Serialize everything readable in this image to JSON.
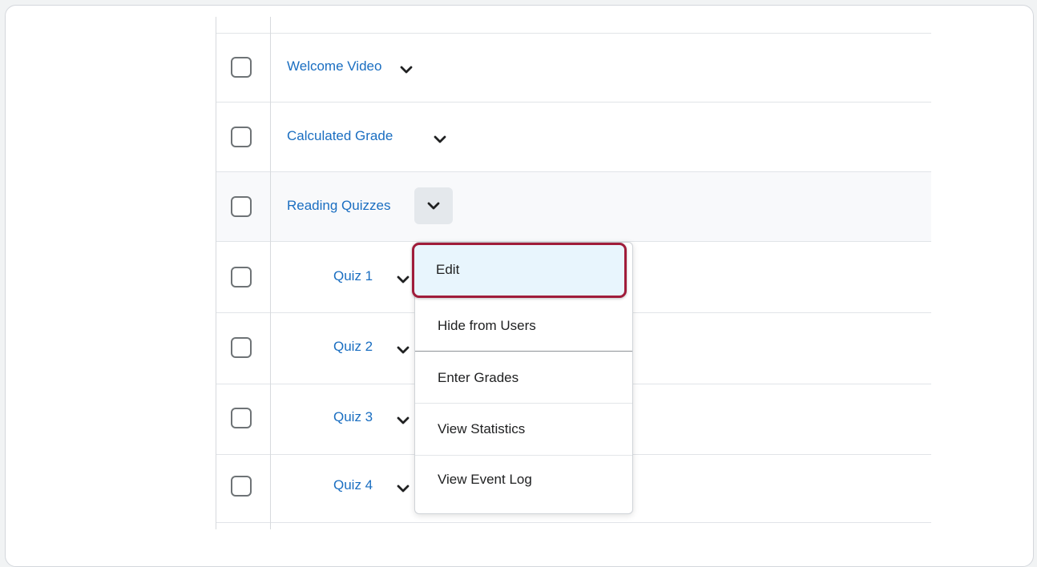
{
  "rows": [
    {
      "label": "Welcome Video",
      "indent": false
    },
    {
      "label": "Calculated Grade",
      "indent": false
    },
    {
      "label": "Reading Quizzes",
      "indent": false,
      "active": true
    },
    {
      "label": "Quiz 1",
      "indent": true
    },
    {
      "label": "Quiz 2",
      "indent": true
    },
    {
      "label": "Quiz 3",
      "indent": true
    },
    {
      "label": "Quiz 4",
      "indent": true
    }
  ],
  "context_menu": {
    "items": [
      {
        "label": "Edit",
        "highlighted": true
      },
      {
        "label": "Hide from Users"
      },
      {
        "label": "Enter Grades"
      },
      {
        "label": "View Statistics"
      },
      {
        "label": "View Event Log"
      }
    ]
  },
  "colors": {
    "link": "#1a6ec1",
    "highlight_border": "#a01c3a",
    "highlight_fill": "#e8f5fd",
    "active_row": "#f8f9fb"
  },
  "icons": {
    "row_toggle": "chevron-down-icon",
    "checkbox": "checkbox-icon"
  }
}
